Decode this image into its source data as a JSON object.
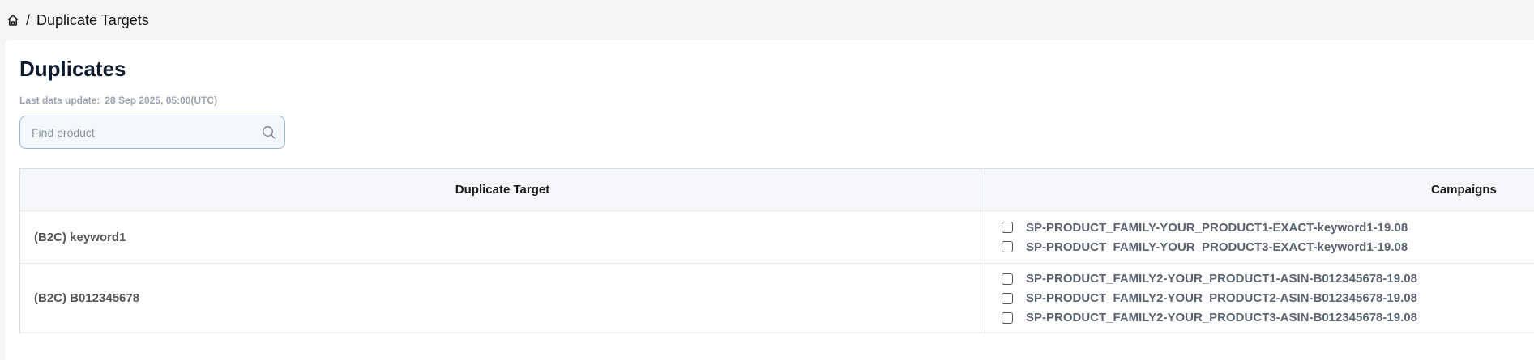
{
  "breadcrumb": {
    "home_icon": "home-icon",
    "separator": "/",
    "current": "Duplicate Targets"
  },
  "page": {
    "title": "Duplicates",
    "last_update_label": "Last data update:",
    "last_update_value": "28 Sep 2025, 05:00(UTC)"
  },
  "search": {
    "placeholder": "Find product",
    "value": "",
    "icon": "search-icon"
  },
  "table": {
    "columns": [
      "Duplicate Target",
      "Campaigns"
    ],
    "rows": [
      {
        "target": "(B2C) keyword1",
        "campaigns": [
          "SP-PRODUCT_FAMILY-YOUR_PRODUCT1-EXACT-keyword1-19.08",
          "SP-PRODUCT_FAMILY-YOUR_PRODUCT3-EXACT-keyword1-19.08"
        ]
      },
      {
        "target": "(B2C) B012345678",
        "campaigns": [
          "SP-PRODUCT_FAMILY2-YOUR_PRODUCT1-ASIN-B012345678-19.08",
          "SP-PRODUCT_FAMILY2-YOUR_PRODUCT2-ASIN-B012345678-19.08",
          "SP-PRODUCT_FAMILY2-YOUR_PRODUCT3-ASIN-B012345678-19.08"
        ]
      }
    ]
  }
}
